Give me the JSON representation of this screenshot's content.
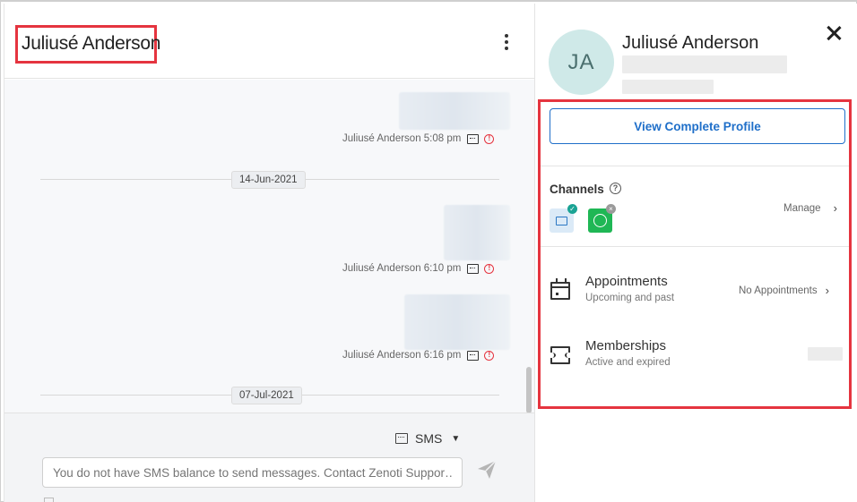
{
  "chat": {
    "contact_name": "Juliusé Anderson",
    "messages": [
      {
        "meta": "Juliusé Anderson 5:08 pm"
      },
      {
        "meta": "Juliusé Anderson 6:10 pm"
      },
      {
        "meta": "Juliusé Anderson 6:16 pm"
      }
    ],
    "date_separators": [
      "14-Jun-2021",
      "07-Jul-2021"
    ],
    "composer": {
      "channel": "SMS",
      "placeholder": "You do not have SMS balance to send messages. Contact Zenoti Suppor…"
    }
  },
  "profile": {
    "initials": "JA",
    "name": "Juliusé Anderson",
    "view_button": "View Complete Profile",
    "channels_title": "Channels",
    "channels": [
      {
        "name": "sms-icon",
        "status": "enabled"
      },
      {
        "name": "whatsapp-icon",
        "status": "disabled"
      }
    ],
    "manage_label": "Manage",
    "rows": [
      {
        "title": "Appointments",
        "subtitle": "Upcoming and past",
        "value": "No Appointments",
        "icon": "calendar-icon"
      },
      {
        "title": "Memberships",
        "subtitle": "Active and expired",
        "value": "",
        "icon": "ticket-icon"
      }
    ]
  },
  "colors": {
    "accent": "#1f6fc9",
    "highlight": "#e5343f",
    "avatar_bg": "#cfe9e8",
    "whatsapp": "#1fb755"
  }
}
